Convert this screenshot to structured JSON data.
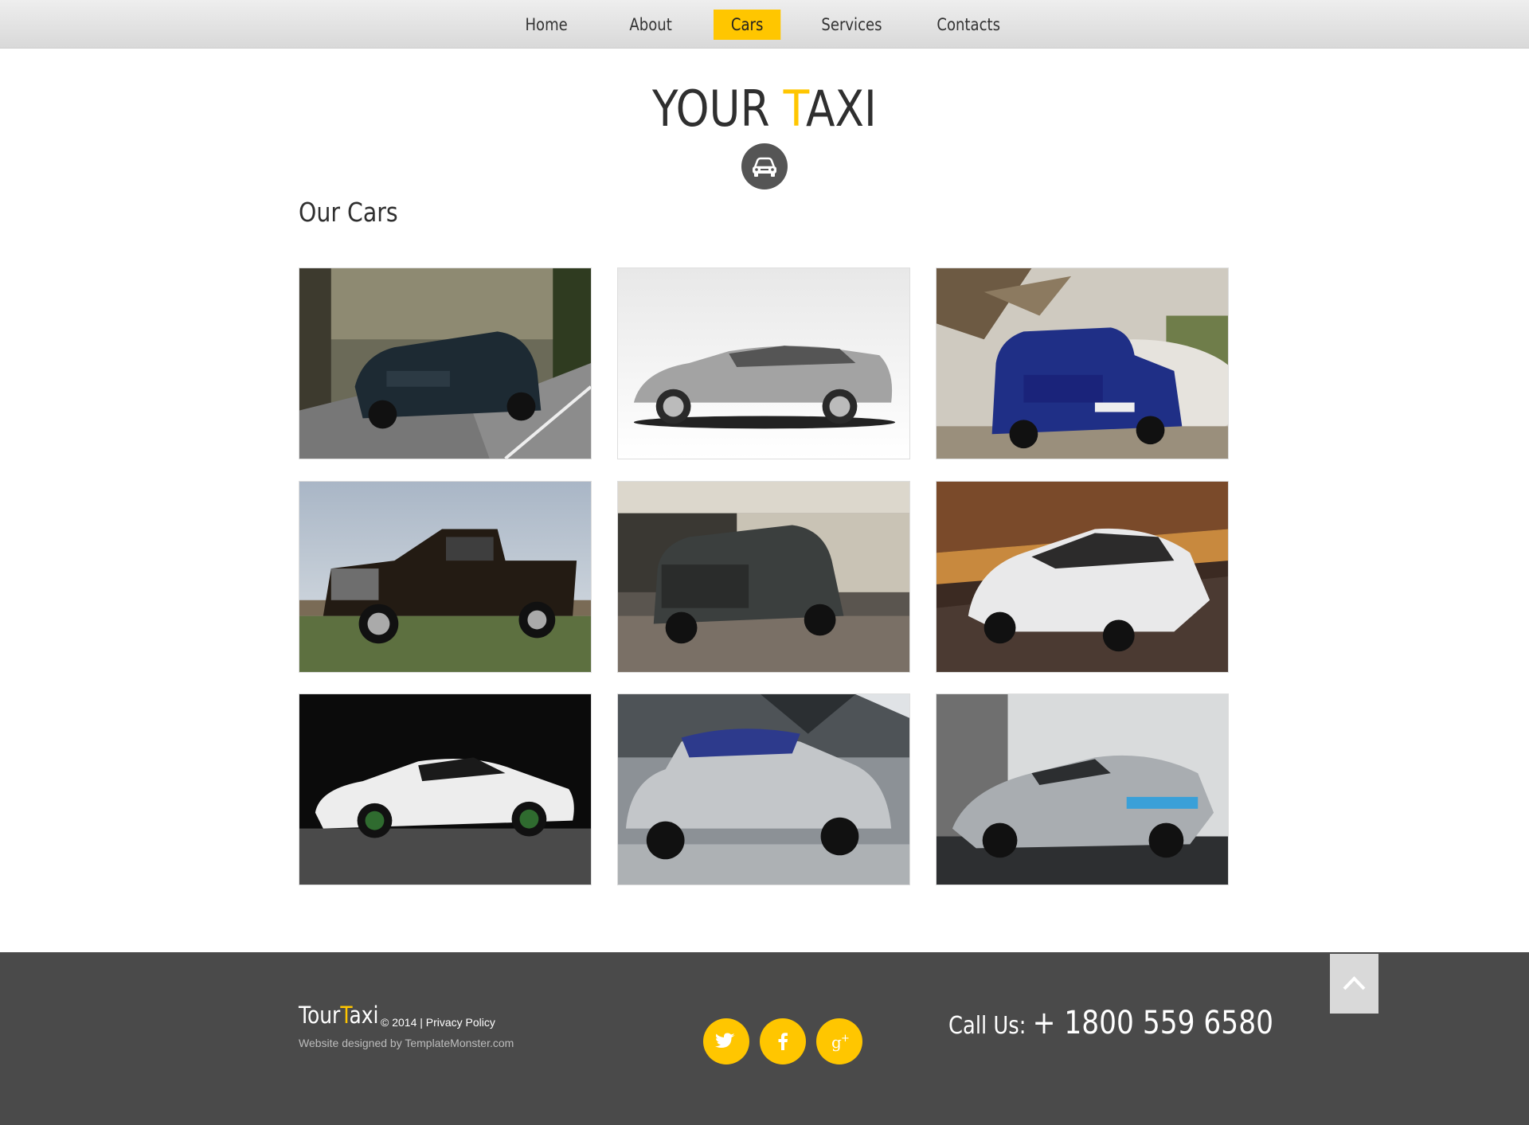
{
  "nav": {
    "items": [
      {
        "label": "Home"
      },
      {
        "label": "About"
      },
      {
        "label": "Cars",
        "active": true
      },
      {
        "label": "Services"
      },
      {
        "label": "Contacts"
      }
    ]
  },
  "header": {
    "logo_part1": "YOUR ",
    "logo_accent": "T",
    "logo_part2": "AXI",
    "badge_icon": "car-icon"
  },
  "main": {
    "section_title": "Our Cars",
    "cars": [
      {
        "icon": "car-photo-dark-wagon-road"
      },
      {
        "icon": "car-photo-silver-wagon"
      },
      {
        "icon": "car-photo-blue-suv-offroad"
      },
      {
        "icon": "car-photo-pickup-truck"
      },
      {
        "icon": "car-photo-grey-suv"
      },
      {
        "icon": "car-photo-white-sedan-motion"
      },
      {
        "icon": "car-photo-white-coupe"
      },
      {
        "icon": "car-photo-silver-hatchback"
      },
      {
        "icon": "car-photo-silver-roadster"
      }
    ]
  },
  "footer": {
    "brand_part1": "Tour",
    "brand_accent": "T",
    "brand_part2": "axi",
    "copyright": "© 2014 | ",
    "privacy": "Privacy Policy",
    "designed_by": "Website designed by TemplateMonster.com",
    "call_label": "Call Us: ",
    "call_number": "+ 1800 559 6580",
    "social": [
      "twitter-icon",
      "facebook-icon",
      "google-plus-icon"
    ],
    "to_top_icon": "chevron-up-icon"
  },
  "colors": {
    "accent": "#ffc600",
    "footer_bg": "#4a4a4a",
    "text_dark": "#2f2f2f"
  }
}
